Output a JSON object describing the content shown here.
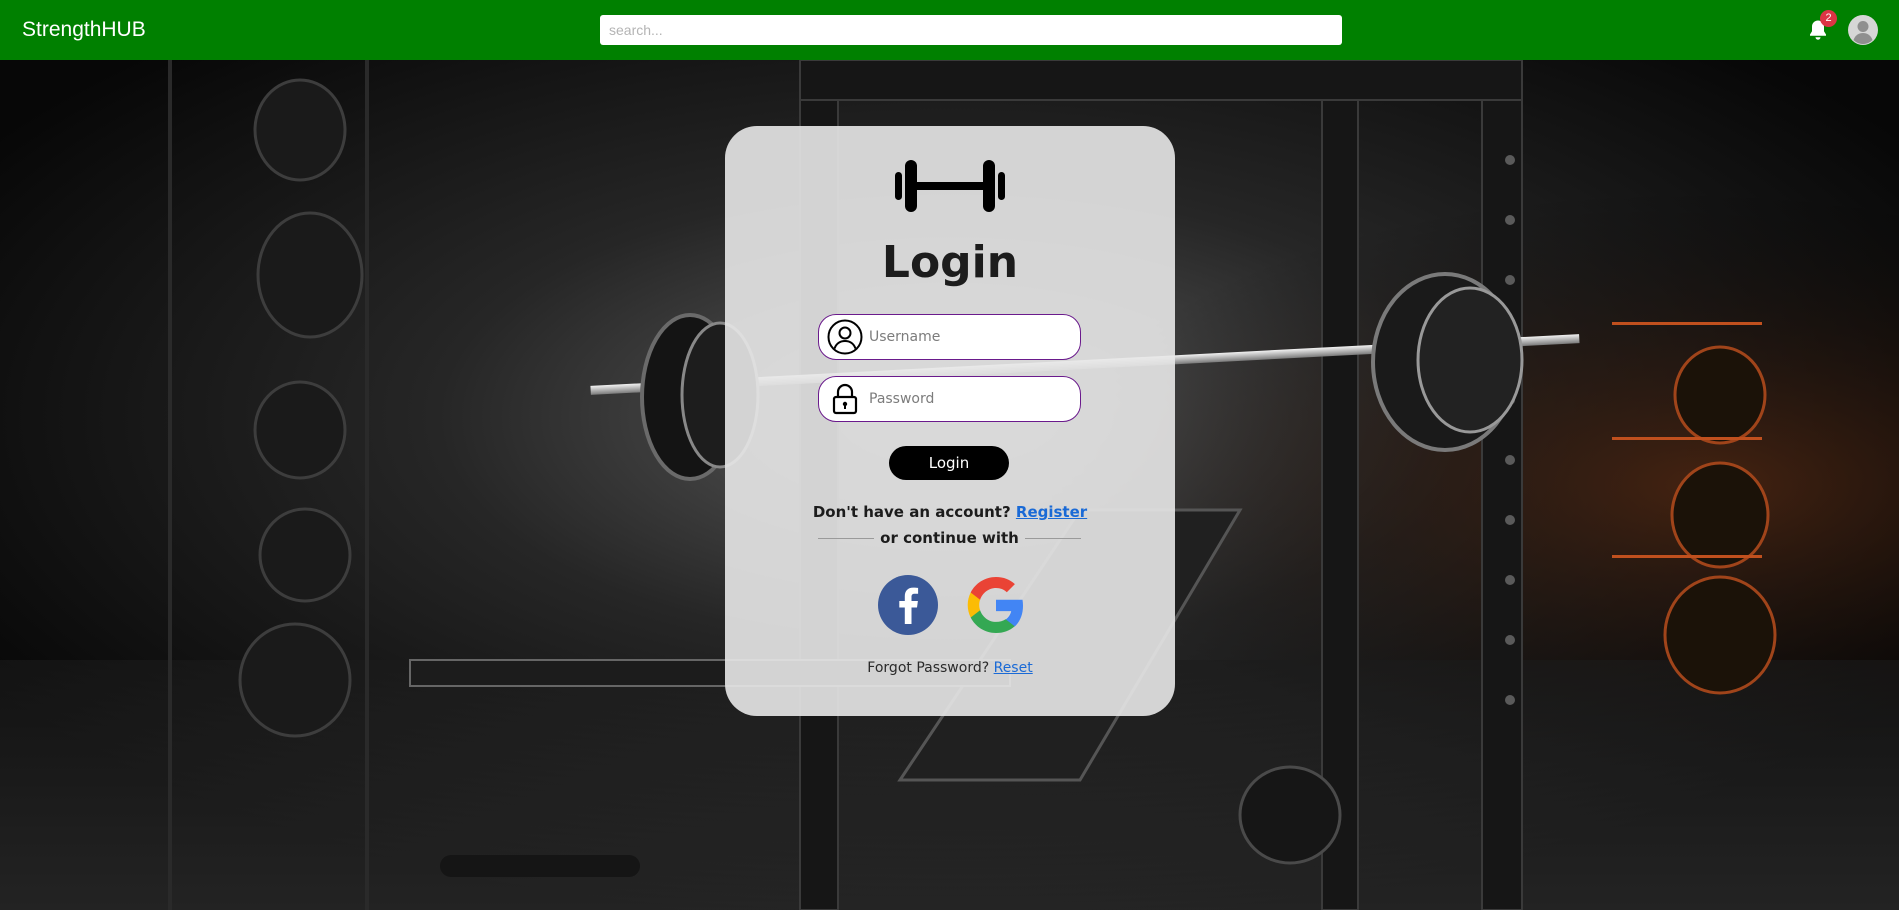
{
  "app": {
    "brand": "StrengthHUB"
  },
  "header": {
    "search_placeholder": "search...",
    "notification_count": "2",
    "icons": [
      "bell-icon",
      "user-avatar-icon"
    ]
  },
  "login": {
    "title": "Login",
    "logo_icon": "dumbbell-icon",
    "username_placeholder": "Username",
    "password_placeholder": "Password",
    "submit_label": "Login",
    "register_prompt": "Don't have an account?",
    "register_link": "Register",
    "continue_with": "or continue with",
    "social": [
      {
        "name": "facebook",
        "icon": "facebook-icon"
      },
      {
        "name": "google",
        "icon": "google-icon"
      }
    ],
    "forgot_prompt": "Forgot Password?",
    "reset_link": "Reset"
  },
  "colors": {
    "navbar": "#008000",
    "badge": "#dc3545",
    "field_border": "#6a1a8c",
    "link": "#1a6ad6",
    "facebook": "#3b5998",
    "button": "#000000"
  }
}
